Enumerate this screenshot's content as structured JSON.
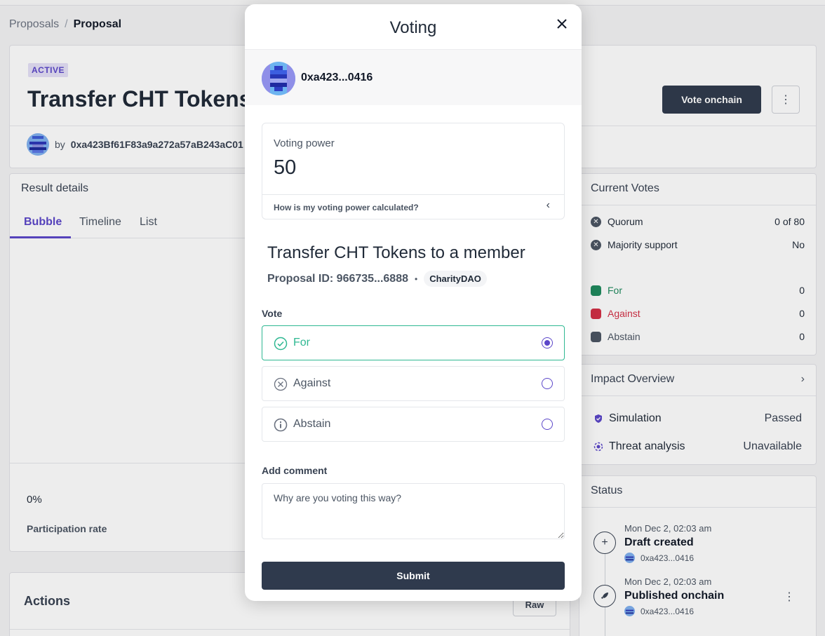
{
  "breadcrumb": {
    "root": "Proposals",
    "separator": "/",
    "current": "Proposal"
  },
  "proposal": {
    "status_badge": "ACTIVE",
    "title": "Transfer CHT Tokens to a member",
    "author_prefix": "by",
    "author_address": "0xa423Bf61F83a9a272a57aB243aC01",
    "vote_button": "Vote onchain",
    "more_icon": "kebab-icon"
  },
  "results": {
    "heading": "Result details",
    "tabs": [
      "Bubble",
      "Timeline",
      "List"
    ],
    "active_tab": "Bubble",
    "participation_value": "0%",
    "participation_label": "Participation rate"
  },
  "actions": {
    "heading": "Actions",
    "raw_button": "Raw"
  },
  "current_votes": {
    "heading": "Current Votes",
    "quorum_label": "Quorum",
    "quorum_value": "0 of 80",
    "majority_label": "Majority support",
    "majority_value": "No",
    "for_label": "For",
    "for_value": "0",
    "against_label": "Against",
    "against_value": "0",
    "abstain_label": "Abstain",
    "abstain_value": "0",
    "colors": {
      "for": "#1f8a5e",
      "against": "#d32f45",
      "abstain": "#4b5563"
    }
  },
  "impact": {
    "heading": "Impact Overview",
    "simulation_label": "Simulation",
    "simulation_value": "Passed",
    "threat_label": "Threat analysis",
    "threat_value": "Unavailable"
  },
  "status": {
    "heading": "Status",
    "events": [
      {
        "date": "Mon Dec 2, 02:03 am",
        "title": "Draft created",
        "address": "0xa423...0416",
        "icon": "plus-icon"
      },
      {
        "date": "Mon Dec 2, 02:03 am",
        "title": "Published onchain",
        "address": "0xa423...0416",
        "icon": "rocket-icon"
      }
    ]
  },
  "modal": {
    "title": "Voting",
    "close_icon": "close-icon",
    "user_address": "0xa423...0416",
    "voting_power_label": "Voting power",
    "voting_power_value": "50",
    "power_help": "How is my voting power calculated?",
    "proposal_title": "Transfer CHT Tokens to a member",
    "proposal_id": "Proposal ID: 966735...6888",
    "dao_name": "CharityDAO",
    "vote_label": "Vote",
    "options": [
      {
        "label": "For",
        "selected": true,
        "icon": "check-circle-icon"
      },
      {
        "label": "Against",
        "selected": false,
        "icon": "x-circle-icon"
      },
      {
        "label": "Abstain",
        "selected": false,
        "icon": "info-circle-icon"
      }
    ],
    "comment_label": "Add comment",
    "comment_placeholder": "Why are you voting this way?",
    "submit_label": "Submit"
  },
  "colors": {
    "accent": "#5b46c9",
    "primary_button": "#2f3a4d",
    "success": "#2fb892"
  }
}
